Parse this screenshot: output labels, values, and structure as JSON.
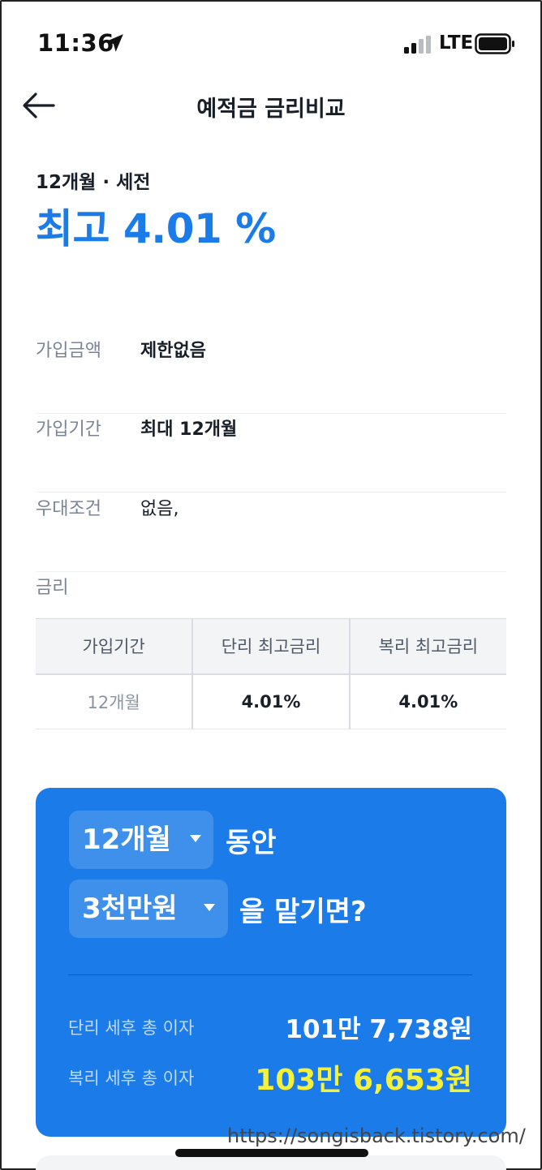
{
  "status_bar": {
    "time": "11:36",
    "network": "LTE"
  },
  "header": {
    "title": "예적금 금리비교"
  },
  "summary": {
    "term_tax": "12개월 · 세전",
    "max_rate": "최고 4.01 %"
  },
  "info": [
    {
      "label": "가입금액",
      "value": "제한없음"
    },
    {
      "label": "가입기간",
      "value": "최대 12개월"
    },
    {
      "label": "우대조건",
      "value": "없음,"
    }
  ],
  "rates": {
    "label": "금리",
    "headers": [
      "가입기간",
      "단리 최고금리",
      "복리 최고금리"
    ],
    "rows": [
      [
        "12개월",
        "4.01%",
        "4.01%"
      ]
    ]
  },
  "calculator": {
    "period_select": "12개월",
    "period_suffix": "동안",
    "amount_select": "3천만원",
    "amount_suffix": "을 맡기면?",
    "simple_label": "단리 세후 총 이자",
    "simple_value": "101만 7,738원",
    "compound_label": "복리 세후 총 이자",
    "compound_value": "103만 6,653원"
  },
  "watermark": "https://songisback.tistory.com/",
  "colors": {
    "accent": "#1b7be8",
    "highlight": "#f5f03a"
  }
}
